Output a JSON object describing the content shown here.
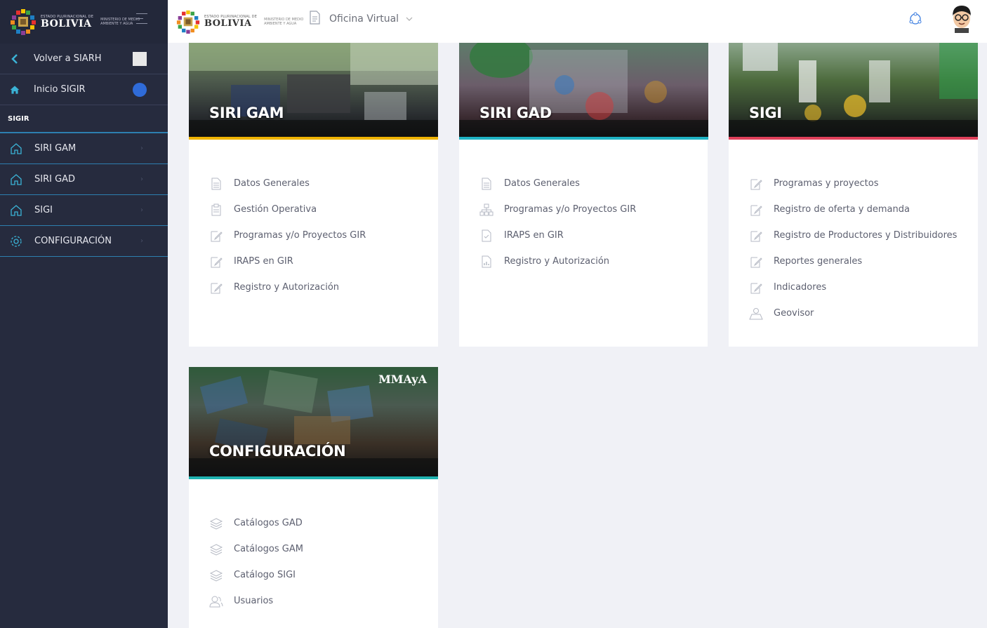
{
  "sidebar": {
    "brand_small": "ESTADO PLURINACIONAL DE",
    "brand_big": "BOLIVIA",
    "brand_sub": "MINISTERIO DE MEDIO AMBIENTE Y AGUA",
    "top_items": [
      {
        "label": "Volver a SIARH",
        "icon": "arrow-left-icon"
      },
      {
        "label": "Inicio SIGIR",
        "icon": "home-icon"
      }
    ],
    "section_label": "SIGIR",
    "items": [
      {
        "label": "SIRI GAM",
        "icon": "home-outline-icon"
      },
      {
        "label": "SIRI GAD",
        "icon": "home-outline-icon"
      },
      {
        "label": "SIGI",
        "icon": "home-outline-icon"
      },
      {
        "label": "CONFIGURACIÓN",
        "icon": "gear-icon"
      }
    ],
    "colors": {
      "bg": "#262b3e",
      "accent": "#2d7fb0",
      "icon": "#3bb3d6"
    }
  },
  "header": {
    "brand_small": "ESTADO PLURINACIONAL DE",
    "brand_big": "BOLIVIA",
    "brand_sub": "MINISTERIO DE MEDIO AMBIENTE Y AGUA",
    "office_label": "Oficina Virtual"
  },
  "cards": [
    {
      "title": "SIRI GAM",
      "accent": "#f0b400",
      "links": [
        {
          "label": "Datos Generales",
          "icon": "document-icon"
        },
        {
          "label": "Gestión Operativa",
          "icon": "clipboard-icon"
        },
        {
          "label": "Programas y/o Proyectos GIR",
          "icon": "edit-icon"
        },
        {
          "label": "IRAPS en GIR",
          "icon": "edit-icon"
        },
        {
          "label": "Registro y Autorización",
          "icon": "edit-icon"
        }
      ]
    },
    {
      "title": "SIRI GAD",
      "accent": "#1fb3c4",
      "links": [
        {
          "label": "Datos Generales",
          "icon": "document-icon"
        },
        {
          "label": "Programas y/o Proyectos GIR",
          "icon": "sitemap-icon"
        },
        {
          "label": "IRAPS en GIR",
          "icon": "check-document-icon"
        },
        {
          "label": "Registro y Autorización",
          "icon": "chart-document-icon"
        }
      ]
    },
    {
      "title": "SIGI",
      "accent": "#e0415a",
      "links": [
        {
          "label": "Programas y proyectos",
          "icon": "edit-icon"
        },
        {
          "label": "Registro de oferta y demanda",
          "icon": "edit-icon"
        },
        {
          "label": "Registro de Productores y Distribuidores",
          "icon": "edit-icon"
        },
        {
          "label": "Reportes generales",
          "icon": "edit-icon"
        },
        {
          "label": "Indicadores",
          "icon": "edit-icon"
        },
        {
          "label": "Geovisor",
          "icon": "map-user-icon"
        }
      ]
    },
    {
      "title": "CONFIGURACIÓN",
      "accent": "#1fb3b0",
      "logo": "MMAyA",
      "links": [
        {
          "label": "Catálogos GAD",
          "icon": "layers-icon"
        },
        {
          "label": "Catálogos GAM",
          "icon": "layers-icon"
        },
        {
          "label": "Catálogo SIGI",
          "icon": "layers-icon"
        },
        {
          "label": "Usuarios",
          "icon": "users-icon"
        }
      ]
    }
  ]
}
